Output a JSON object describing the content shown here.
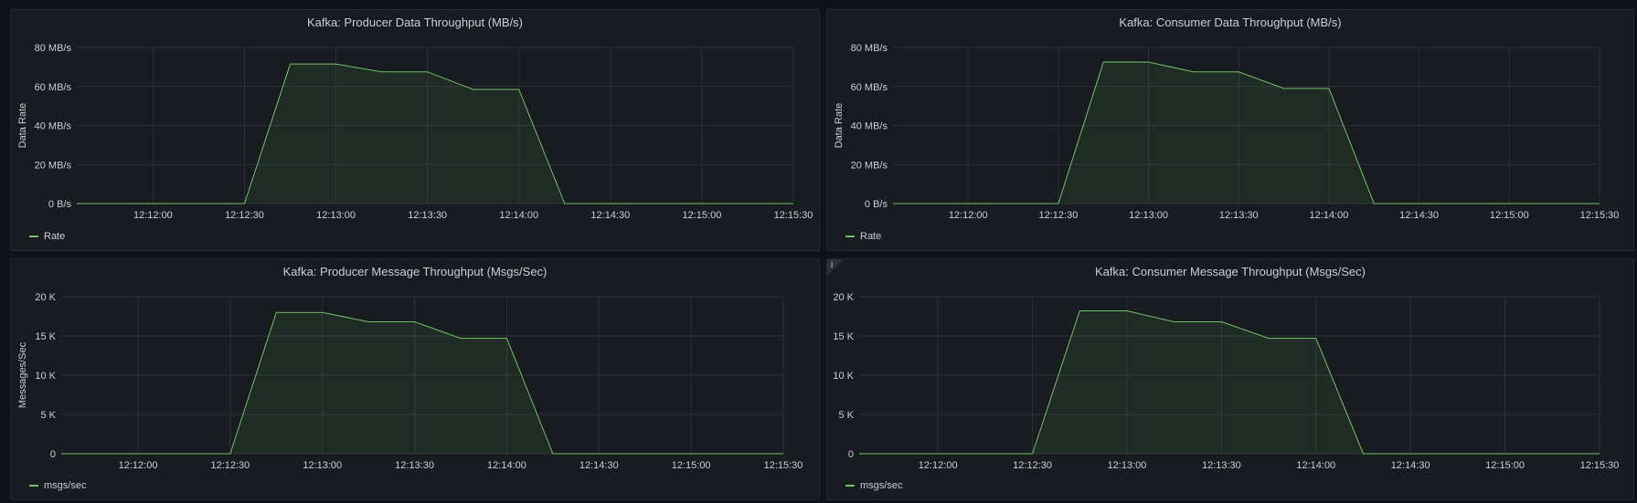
{
  "theme": {
    "series_color": "#73bf69",
    "grid_color": "#2c2f35",
    "background": "#181b1f",
    "text_color": "#ccccdc"
  },
  "panels": [
    {
      "title": "Kafka: Producer Data Throughput (MB/s)",
      "legend": "Rate",
      "has_info": false
    },
    {
      "title": "Kafka: Consumer Data Throughput (MB/s)",
      "legend": "Rate",
      "has_info": false
    },
    {
      "title": "Kafka: Producer Message Throughput (Msgs/Sec)",
      "legend": "msgs/sec",
      "has_info": false
    },
    {
      "title": "Kafka: Consumer Message Throughput (Msgs/Sec)",
      "legend": "msgs/sec",
      "has_info": true,
      "info_glyph": "i"
    }
  ],
  "chart_data": [
    {
      "type": "area",
      "title": "Kafka: Producer Data Throughput (MB/s)",
      "ylabel": "Data Rate",
      "xlabel": "",
      "x_ticks": [
        "12:12:00",
        "12:12:30",
        "12:13:00",
        "12:13:30",
        "12:14:00",
        "12:14:30",
        "12:15:00",
        "12:15:30"
      ],
      "y_ticks": [
        "0 B/s",
        "20 MB/s",
        "40 MB/s",
        "60 MB/s",
        "80 MB/s"
      ],
      "ylim": [
        0,
        80
      ],
      "xlim": [
        "12:11:35",
        "12:15:30"
      ],
      "grid": true,
      "legend_position": "bottom-left",
      "series": [
        {
          "name": "Rate",
          "x": [
            "12:11:35",
            "12:12:30",
            "12:12:45",
            "12:13:00",
            "12:13:15",
            "12:13:30",
            "12:13:45",
            "12:14:00",
            "12:14:15",
            "12:15:30"
          ],
          "values": [
            0,
            0,
            71.5,
            71.5,
            67.5,
            67.5,
            58.5,
            58.5,
            0,
            0
          ],
          "unit": "MB/s"
        }
      ]
    },
    {
      "type": "area",
      "title": "Kafka: Consumer Data Throughput (MB/s)",
      "ylabel": "Data Rate",
      "xlabel": "",
      "x_ticks": [
        "12:12:00",
        "12:12:30",
        "12:13:00",
        "12:13:30",
        "12:14:00",
        "12:14:30",
        "12:15:00",
        "12:15:30"
      ],
      "y_ticks": [
        "0 B/s",
        "20 MB/s",
        "40 MB/s",
        "60 MB/s",
        "80 MB/s"
      ],
      "ylim": [
        0,
        80
      ],
      "xlim": [
        "12:11:35",
        "12:15:30"
      ],
      "grid": true,
      "legend_position": "bottom-left",
      "series": [
        {
          "name": "Rate",
          "x": [
            "12:11:35",
            "12:12:30",
            "12:12:45",
            "12:13:00",
            "12:13:15",
            "12:13:30",
            "12:13:45",
            "12:14:00",
            "12:14:15",
            "12:15:30"
          ],
          "values": [
            0,
            0,
            72.5,
            72.5,
            67.5,
            67.5,
            59,
            59,
            0,
            0
          ],
          "unit": "MB/s"
        }
      ]
    },
    {
      "type": "area",
      "title": "Kafka: Producer Message Throughput (Msgs/Sec)",
      "ylabel": "Messages/Sec",
      "xlabel": "",
      "x_ticks": [
        "12:12:00",
        "12:12:30",
        "12:13:00",
        "12:13:30",
        "12:14:00",
        "12:14:30",
        "12:15:00",
        "12:15:30"
      ],
      "y_ticks": [
        "0",
        "5 K",
        "10 K",
        "15 K",
        "20 K"
      ],
      "ylim": [
        0,
        20000
      ],
      "xlim": [
        "12:11:35",
        "12:15:30"
      ],
      "grid": true,
      "legend_position": "bottom-left",
      "series": [
        {
          "name": "msgs/sec",
          "x": [
            "12:11:35",
            "12:12:30",
            "12:12:45",
            "12:13:00",
            "12:13:15",
            "12:13:30",
            "12:13:45",
            "12:14:00",
            "12:14:15",
            "12:15:30"
          ],
          "values": [
            0,
            0,
            18000,
            18000,
            16800,
            16800,
            14700,
            14700,
            0,
            0
          ],
          "unit": "msgs/sec"
        }
      ]
    },
    {
      "type": "area",
      "title": "Kafka: Consumer Message Throughput (Msgs/Sec)",
      "ylabel": "",
      "xlabel": "",
      "x_ticks": [
        "12:12:00",
        "12:12:30",
        "12:13:00",
        "12:13:30",
        "12:14:00",
        "12:14:30",
        "12:15:00",
        "12:15:30"
      ],
      "y_ticks": [
        "0",
        "5 K",
        "10 K",
        "15 K",
        "20 K"
      ],
      "ylim": [
        0,
        20000
      ],
      "xlim": [
        "12:11:35",
        "12:15:30"
      ],
      "grid": true,
      "legend_position": "bottom-left",
      "series": [
        {
          "name": "msgs/sec",
          "x": [
            "12:11:35",
            "12:12:30",
            "12:12:45",
            "12:13:00",
            "12:13:15",
            "12:13:30",
            "12:13:45",
            "12:14:00",
            "12:14:15",
            "12:15:30"
          ],
          "values": [
            0,
            0,
            18200,
            18200,
            16800,
            16800,
            14700,
            14700,
            0,
            0
          ],
          "unit": "msgs/sec"
        }
      ]
    }
  ]
}
